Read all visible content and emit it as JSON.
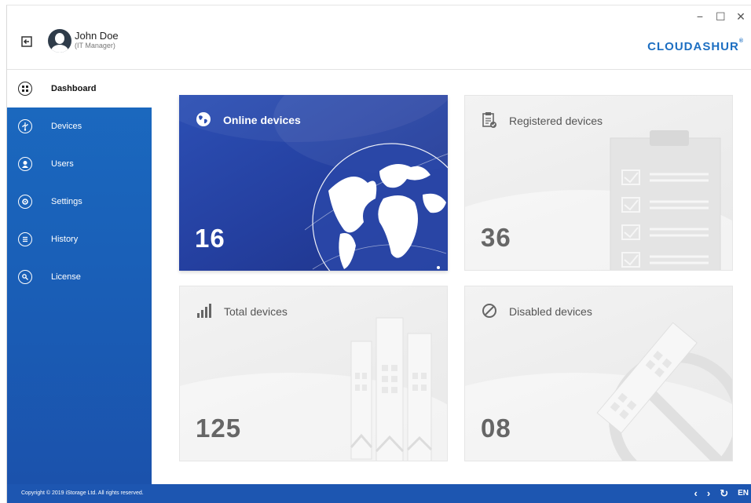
{
  "header": {
    "user_name": "John Doe",
    "user_role": "(IT Manager)",
    "brand": "CLOUDASHUR",
    "brand_mark": "®",
    "window_controls": {
      "minimize": "−",
      "maximize": "☐",
      "close": "✕"
    }
  },
  "sidebar": {
    "items": [
      {
        "label": "Dashboard",
        "icon": "grid-icon",
        "active": true
      },
      {
        "label": "Devices",
        "icon": "usb-icon"
      },
      {
        "label": "Users",
        "icon": "user-icon"
      },
      {
        "label": "Settings",
        "icon": "gear-icon"
      },
      {
        "label": "History",
        "icon": "list-icon"
      },
      {
        "label": "License",
        "icon": "key-icon"
      }
    ]
  },
  "cards": {
    "online": {
      "title": "Online devices",
      "count": "16",
      "icon": "globe-icon"
    },
    "registered": {
      "title": "Registered devices",
      "count": "36",
      "icon": "clipboard-icon"
    },
    "total": {
      "title": "Total devices",
      "count": "125",
      "icon": "bar-chart-icon"
    },
    "disabled": {
      "title": "Disabled devices",
      "count": "08",
      "icon": "prohibited-icon"
    }
  },
  "footer": {
    "copyright": "Copyright © 2019 iStorage Ltd. All rights reserved.",
    "back": "‹",
    "forward": "›",
    "refresh": "↻",
    "language": "EN"
  },
  "colors": {
    "accent": "#1b6ac0",
    "card_blue": "#243f9f",
    "brand": "#1d6fc2"
  }
}
